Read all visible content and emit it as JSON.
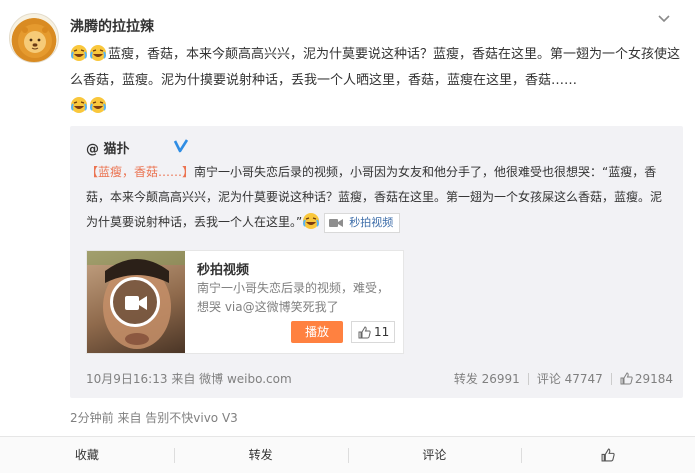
{
  "post": {
    "username": "沸腾的拉拉辣",
    "text_seg1": "蓝瘦，香菇，本来今颠高高兴兴，泥为什莫要说这种话？蓝瘦，香菇在这里。第一翅为一个女孩使这么香菇，蓝瘦。泥为什摸要说射种话，丢我一个人晒这里，香菇，蓝瘦在这里，香菇……",
    "meta": "2分钟前 来自 告别不快vivo V3"
  },
  "repost": {
    "username": "@ 猫扑",
    "tag": "【蓝瘦，香菇……】",
    "text_seg1": "南宁一小哥失恋后录的视频，小哥因为女友和他分手了，他很难受也很想哭：“蓝瘦，香菇，本来今颠高高兴兴，泥为什莫要说这种话？蓝瘦，香菇在这里。第一翅为一个女孩屎这么香菇，蓝瘦。泥为什莫要说射种话，丢我一个人在这里。”",
    "video_link": "秒拍视频",
    "video_card": {
      "title": "秒拍视频",
      "desc": "南宁一小哥失恋后录的视频，难受，想哭 via@这微博笑死我了",
      "play_label": "播放",
      "like_count": "11"
    },
    "time": "10月9日16:13",
    "source": "来自 微博 weibo.com",
    "repost_label": "转发 26991",
    "comment_label": "评论 47747",
    "like_count": "29184"
  },
  "actions": {
    "fav": "收藏",
    "repost": "转发",
    "comment": "评论"
  },
  "colors": {
    "accent": "#eb7350",
    "link": "#3c6ca8",
    "play_button": "#ff8140",
    "verified": "#2f8de4"
  },
  "icons": {
    "avatar": "lion-avatar",
    "laugh": "laugh-cry-emoji",
    "verified": "verified-v-badge",
    "camera": "video-camera-icon",
    "thumb": "thumbs-up-icon",
    "chevron": "chevron-down-icon"
  }
}
